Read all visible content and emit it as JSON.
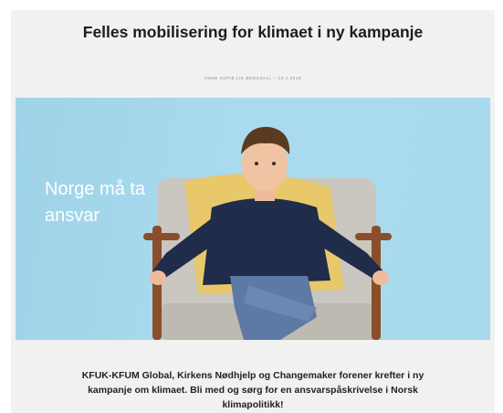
{
  "article": {
    "title": "Felles mobilisering for klimaet i ny kampanje",
    "byline": "ANNE SOFIE LIE BERGSALL – 23.4.2019",
    "hero_text": "Norge må ta ansvar",
    "lead": "KFUK-KFUM Global, Kirkens Nødhjelp og Changemaker forener krefter i ny kampanje om klimaet. Bli med og sørg for en ansvarspåskrivelse i Norsk klimapolitikk!"
  },
  "colors": {
    "hero_background": "#a8d9ec",
    "card_background": "#f1f1f1",
    "title_text": "#1d1d1d"
  }
}
